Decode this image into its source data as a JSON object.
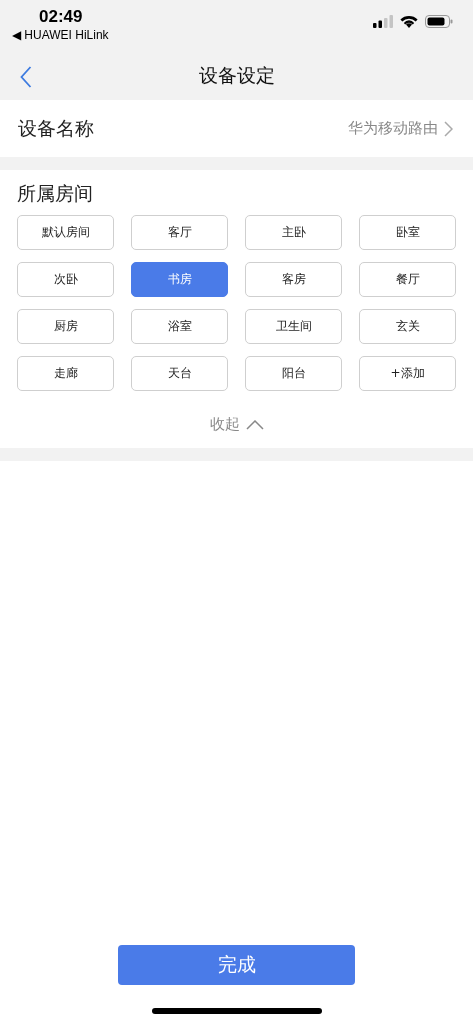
{
  "status_bar": {
    "time": "02:49",
    "back_app": "◀ HUAWEI HiLink"
  },
  "nav": {
    "title": "设备设定"
  },
  "device_name": {
    "label": "设备名称",
    "value": "华为移动路由"
  },
  "rooms": {
    "title": "所属房间",
    "items": [
      {
        "label": "默认房间",
        "selected": false
      },
      {
        "label": "客厅",
        "selected": false
      },
      {
        "label": "主卧",
        "selected": false
      },
      {
        "label": "卧室",
        "selected": false
      },
      {
        "label": "次卧",
        "selected": false
      },
      {
        "label": "书房",
        "selected": true
      },
      {
        "label": "客房",
        "selected": false
      },
      {
        "label": "餐厅",
        "selected": false
      },
      {
        "label": "厨房",
        "selected": false
      },
      {
        "label": "浴室",
        "selected": false
      },
      {
        "label": "卫生间",
        "selected": false
      },
      {
        "label": "玄关",
        "selected": false
      },
      {
        "label": "走廊",
        "selected": false
      },
      {
        "label": "天台",
        "selected": false
      },
      {
        "label": "阳台",
        "selected": false
      },
      {
        "label": "+添加",
        "selected": false
      }
    ],
    "toggle": {
      "label": "收起",
      "expanded": true
    }
  },
  "done_button": "完成"
}
